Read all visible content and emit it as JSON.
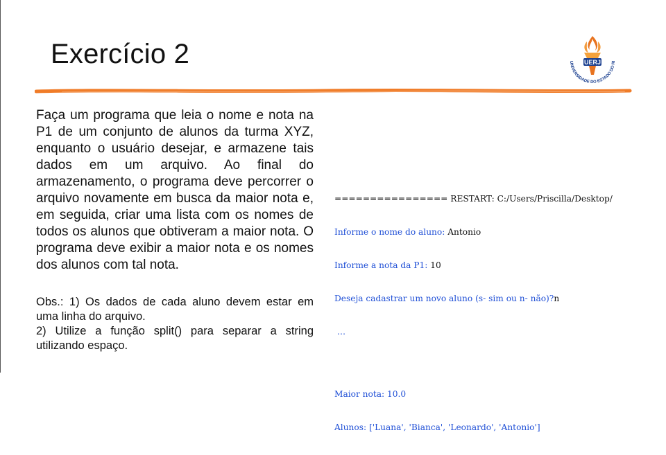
{
  "slide": {
    "title": "Exercício 2",
    "logo": {
      "icon": "uerj-torch-logo",
      "text": "UERJ",
      "ring_text": "UNIVERSIDADE DO ESTADO DO RIO DE JANEIRO",
      "colors": {
        "flame": "#e8731f",
        "ring": "#1a3f8f",
        "badge": "#1a3f8f"
      }
    },
    "rule_color": "#f07c28",
    "description": "Faça um programa que leia o nome e nota na P1 de um conjunto de alunos da turma XYZ, enquanto o usuário desejar, e armazene tais dados em um arquivo. Ao final do armazenamento, o programa deve percorrer o arquivo novamente em busca da maior nota e, em seguida, criar uma lista com os nomes de todos os alunos que obtiveram a maior nota. O programa deve exibir a maior nota e os nomes dos alunos com tal nota.",
    "obs_line1": "Obs.: 1) Os dados de cada aluno devem estar em uma linha do arquivo.",
    "obs_line2": "2) Utilize a função split() para separar a string utilizando espaço.",
    "console": {
      "restart": "================ RESTART: C:/Users/Priscilla/Desktop/",
      "prompt_name": "Informe o nome do aluno: ",
      "input_name": "Antonio",
      "prompt_grade": "Informe a nota da P1: ",
      "input_grade": "10",
      "prompt_continue": "Deseja cadastrar um novo aluno (s- sim ou n- não)?",
      "input_continue": "n",
      "ellipsis": " …",
      "max_grade": "Maior nota: 10.0",
      "students": "Alunos: ['Luana', 'Bianca', 'Leonardo', 'Antonio']"
    },
    "colors": {
      "console_blue": "#1f4fd6",
      "text": "#111111"
    }
  }
}
